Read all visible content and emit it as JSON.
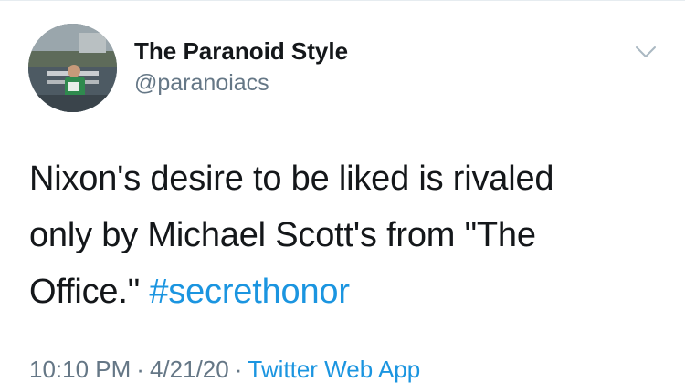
{
  "user": {
    "display_name": "The Paranoid Style",
    "handle": "@paranoiacs"
  },
  "tweet": {
    "line1": "Nixon's desire to be liked is rivaled",
    "line2": "only by Michael Scott's from \"The",
    "line3_text": "Office.\"",
    "hashtag": "#secrethonor"
  },
  "meta": {
    "time": "10:10 PM",
    "separator": "·",
    "date": "4/21/20",
    "source": "Twitter Web App"
  },
  "icons": {
    "more": "chevron-down-icon"
  },
  "colors": {
    "link": "#1b95e0",
    "secondary_text": "#657786",
    "primary_text": "#14171a"
  }
}
